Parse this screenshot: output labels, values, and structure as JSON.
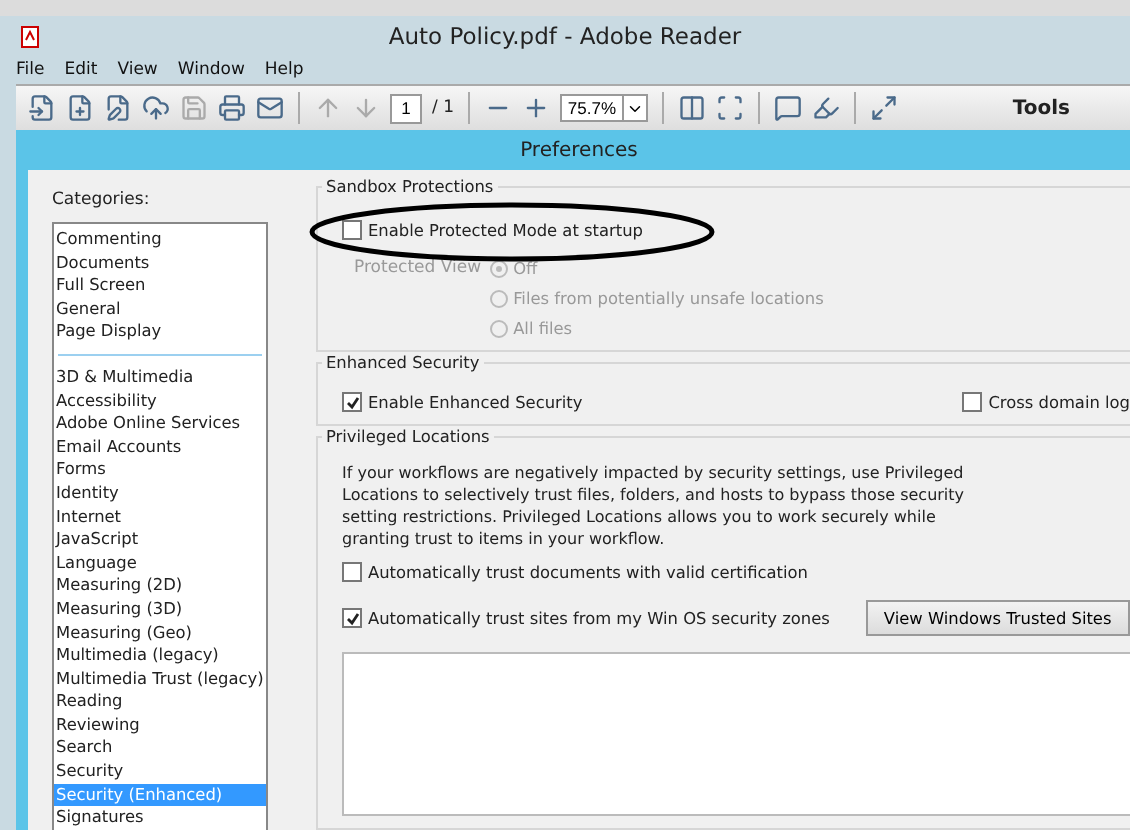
{
  "window": {
    "title": "Auto Policy.pdf - Adobe Reader"
  },
  "menu": [
    "File",
    "Edit",
    "View",
    "Window",
    "Help"
  ],
  "toolbar": {
    "page_number": "1",
    "page_total": "/ 1",
    "zoom": "75.7%",
    "tools": "Tools"
  },
  "dialog": {
    "title": "Preferences",
    "categories_label": "Categories:",
    "category_groups": [
      [
        {
          "label": "Commenting",
          "selected": false
        },
        {
          "label": "Documents",
          "selected": false
        },
        {
          "label": "Full Screen",
          "selected": false
        },
        {
          "label": "General",
          "selected": false
        },
        {
          "label": "Page Display",
          "selected": false
        }
      ],
      [
        {
          "label": "3D & Multimedia",
          "selected": false
        },
        {
          "label": "Accessibility",
          "selected": false
        },
        {
          "label": "Adobe Online Services",
          "selected": false
        },
        {
          "label": "Email Accounts",
          "selected": false
        },
        {
          "label": "Forms",
          "selected": false
        },
        {
          "label": "Identity",
          "selected": false
        },
        {
          "label": "Internet",
          "selected": false
        },
        {
          "label": "JavaScript",
          "selected": false
        },
        {
          "label": "Language",
          "selected": false
        },
        {
          "label": "Measuring (2D)",
          "selected": false
        },
        {
          "label": "Measuring (3D)",
          "selected": false
        },
        {
          "label": "Measuring (Geo)",
          "selected": false
        },
        {
          "label": "Multimedia (legacy)",
          "selected": false
        },
        {
          "label": "Multimedia Trust (legacy)",
          "selected": false
        },
        {
          "label": "Reading",
          "selected": false
        },
        {
          "label": "Reviewing",
          "selected": false
        },
        {
          "label": "Search",
          "selected": false
        },
        {
          "label": "Security",
          "selected": false
        },
        {
          "label": "Security (Enhanced)",
          "selected": true
        },
        {
          "label": "Signatures",
          "selected": false
        }
      ]
    ],
    "sandbox": {
      "title": "Sandbox Protections",
      "protected_mode": {
        "label": "Enable Protected Mode at startup",
        "checked": false
      },
      "protected_view": {
        "label": "Protected View",
        "disabled": true,
        "options": [
          {
            "label": "Off",
            "selected": true
          },
          {
            "label": "Files from potentially unsafe locations",
            "selected": false
          },
          {
            "label": "All files",
            "selected": false
          }
        ]
      }
    },
    "enhanced": {
      "title": "Enhanced Security",
      "options": [
        {
          "label": "Enable Enhanced Security",
          "checked": true
        },
        {
          "label": "Cross domain log",
          "checked": false
        }
      ]
    },
    "privileged": {
      "title": "Privileged Locations",
      "description": "If your workflows are negatively impacted by security settings, use Privileged Locations to selectively trust files, folders, and hosts to bypass those security setting restrictions. Privileged Locations allows you to work securely while granting trust to items in your workflow.",
      "certified": {
        "label": "Automatically trust documents with valid certification",
        "checked": false
      },
      "win_sites": {
        "label": "Automatically trust sites from my Win OS security zones",
        "checked": true
      },
      "view_button": "View Windows Trusted Sites"
    }
  }
}
